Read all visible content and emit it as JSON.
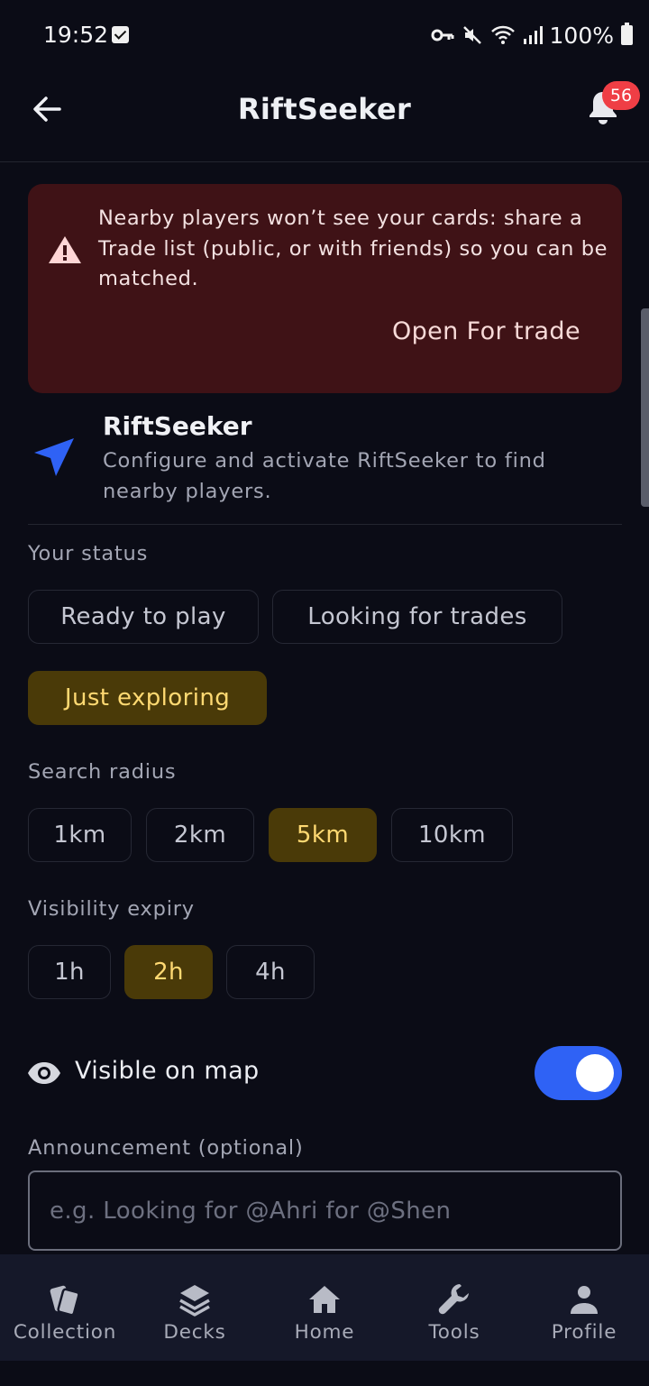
{
  "status_bar": {
    "time": "19:52",
    "battery": "100%",
    "icons": [
      "checkbox-notification-icon",
      "vpn-key-icon",
      "mute-icon",
      "wifi-icon",
      "signal-icon",
      "battery-icon"
    ]
  },
  "app_bar": {
    "title": "RiftSeeker",
    "notification_count": "56"
  },
  "warning": {
    "text": "Nearby players won’t see your cards: share a Trade list (public, or with friends) so you can be matched.",
    "action_label": "Open For trade"
  },
  "feature": {
    "title": "RiftSeeker",
    "description": "Configure and activate RiftSeeker to find nearby players."
  },
  "status": {
    "label": "Your status",
    "options": [
      "Ready to play",
      "Looking for trades",
      "Just exploring"
    ],
    "selected": "Just exploring"
  },
  "radius": {
    "label": "Search radius",
    "options": [
      "1km",
      "2km",
      "5km",
      "10km"
    ],
    "selected": "5km"
  },
  "expiry": {
    "label": "Visibility expiry",
    "options": [
      "1h",
      "2h",
      "4h"
    ],
    "selected": "2h"
  },
  "visibility": {
    "label": "Visible on map",
    "enabled": true
  },
  "announcement": {
    "label": "Announcement (optional)",
    "placeholder": "e.g. Looking for @Ahri for @Shen",
    "value": ""
  },
  "nav": {
    "items": [
      {
        "label": "Collection",
        "icon": "cards-icon"
      },
      {
        "label": "Decks",
        "icon": "layers-icon"
      },
      {
        "label": "Home",
        "icon": "home-icon"
      },
      {
        "label": "Tools",
        "icon": "wrench-icon"
      },
      {
        "label": "Profile",
        "icon": "person-icon"
      }
    ]
  },
  "colors": {
    "background": "#0b0c16",
    "warning_bg": "#3f1216",
    "accent_blue": "#2f62f5",
    "chip_selected_bg": "#4a3a08",
    "chip_selected_text": "#ffd972",
    "badge": "#ef3e45"
  }
}
